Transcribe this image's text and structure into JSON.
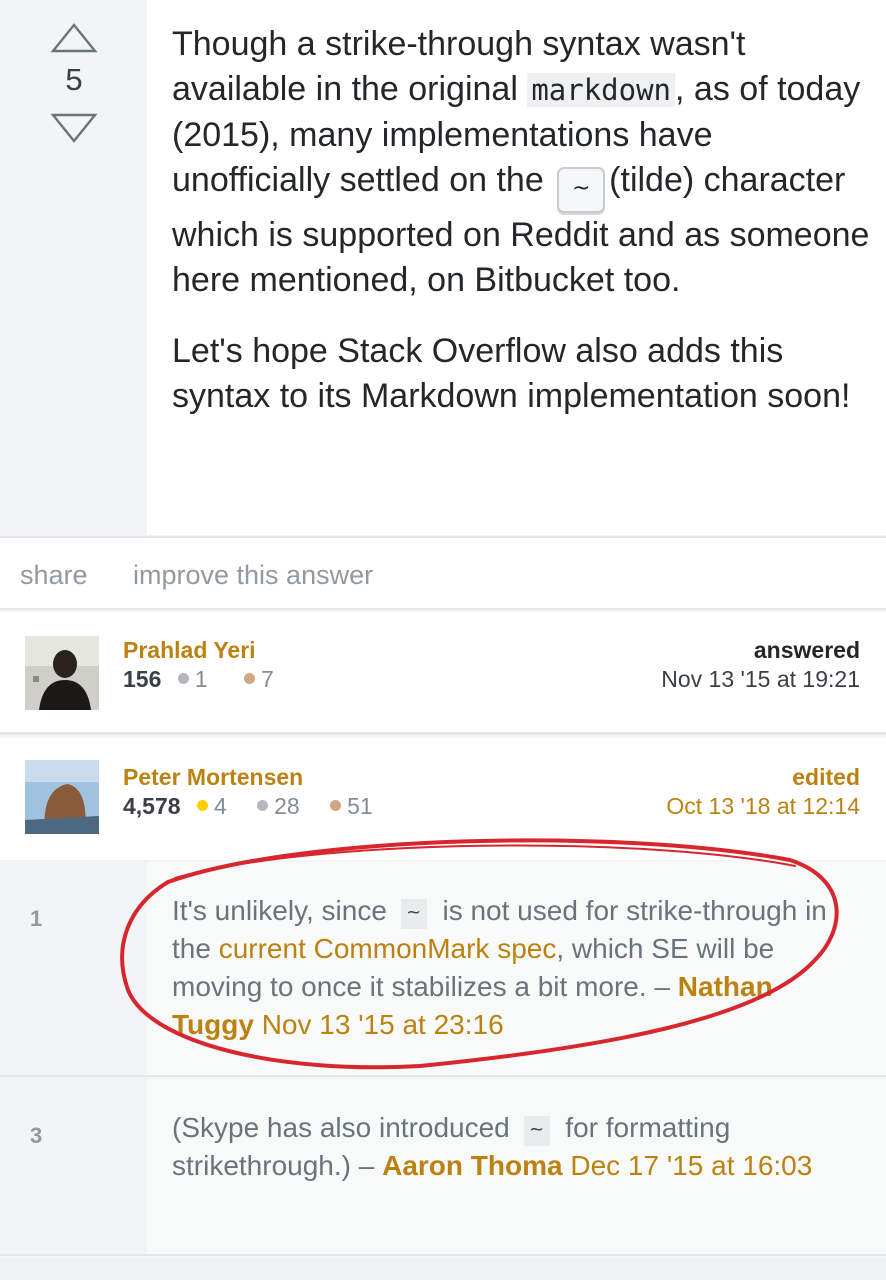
{
  "answer": {
    "vote_count": "5",
    "body": {
      "p1_part1": "Though a strike-through syntax wasn't available in the original ",
      "p1_code": "markdown",
      "p1_part2": ", as of today (2015), many implementations have unofficially settled on the ",
      "p1_kbd": "~",
      "p1_part3": "(tilde) character which is supported on Reddit and as someone here mentioned, on Bitbucket too.",
      "p2": "Let's hope Stack Overflow also adds this syntax to its Markdown implementation soon!"
    }
  },
  "menu": {
    "share": "share",
    "improve": "improve this answer"
  },
  "answered_by": {
    "name": "Prahlad Yeri",
    "reputation": "156",
    "silver": "1",
    "bronze": "7",
    "action": "answered",
    "time": "Nov 13 '15 at 19:21"
  },
  "edited_by": {
    "name": "Peter Mortensen",
    "reputation": "4,578",
    "gold": "4",
    "silver": "28",
    "bronze": "51",
    "action": "edited",
    "time": "Oct 13 '18 at 12:14"
  },
  "comments": [
    {
      "score": "1",
      "text_a": "It's unlikely, since ",
      "kbd": "~",
      "text_b": " is not used for strike-through in the ",
      "link": "current CommonMark spec",
      "text_c": ", which SE will be moving to once it stabilizes a bit more. – ",
      "user": "Nathan Tuggy",
      "date": "Nov 13 '15 at 23:16"
    },
    {
      "score": "3",
      "text_a": "(Skype has also introduced ",
      "kbd": "~",
      "text_b": " for formatting strikethrough.) – ",
      "user": "Aaron Thoma",
      "date": "Dec 17 '15 at 16:03"
    }
  ],
  "colors": {
    "link_orange": "#bc8211",
    "gold_badge": "#ffcc01",
    "silver_badge": "#b4b8bc",
    "bronze_badge": "#d1a684",
    "annotation_red": "#d8262f"
  }
}
